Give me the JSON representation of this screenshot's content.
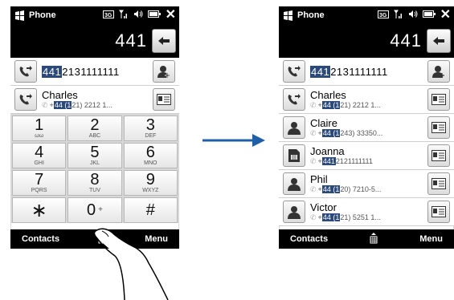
{
  "left": {
    "status": {
      "title": "Phone"
    },
    "number": "441",
    "rows": [
      {
        "hl": "441",
        "rest": "2131111111"
      },
      {
        "name": "Charles",
        "pre": "+",
        "hl": "44 (1",
        "rest": "21) 2212 1..."
      }
    ],
    "keys": [
      {
        "d": "1",
        "l": "ωω"
      },
      {
        "d": "2",
        "l": "ABC"
      },
      {
        "d": "3",
        "l": "DEF"
      },
      {
        "d": "4",
        "l": "GHI"
      },
      {
        "d": "5",
        "l": "JKL"
      },
      {
        "d": "6",
        "l": "MNO"
      },
      {
        "d": "7",
        "l": "PQRS"
      },
      {
        "d": "8",
        "l": "TUV"
      },
      {
        "d": "9",
        "l": "WXYZ"
      },
      {
        "d": "∗",
        "l": ""
      },
      {
        "d": "0",
        "l": "+"
      },
      {
        "d": "#",
        "l": ""
      }
    ],
    "softkeys": {
      "left": "Contacts",
      "right": "Menu"
    }
  },
  "right": {
    "status": {
      "title": "Phone"
    },
    "number": "441",
    "rows": [
      {
        "hl": "441",
        "rest": "2131111111"
      },
      {
        "name": "Charles",
        "pre": "+",
        "hl": "44 (1",
        "rest": "21) 2212 1..."
      },
      {
        "name": "Claire",
        "pre": "+",
        "hl": "44 (1",
        "rest": "243) 33350..."
      },
      {
        "name": "Joanna",
        "pre": "+",
        "hl": "441",
        "rest": "2121111111"
      },
      {
        "name": "Phil",
        "pre": "+",
        "hl": "44 (1",
        "rest": "20) 7210-5..."
      },
      {
        "name": "Victor",
        "pre": "+",
        "hl": "44 (1",
        "rest": "21) 5251 1..."
      }
    ],
    "softkeys": {
      "left": "Contacts",
      "right": "Menu"
    }
  }
}
